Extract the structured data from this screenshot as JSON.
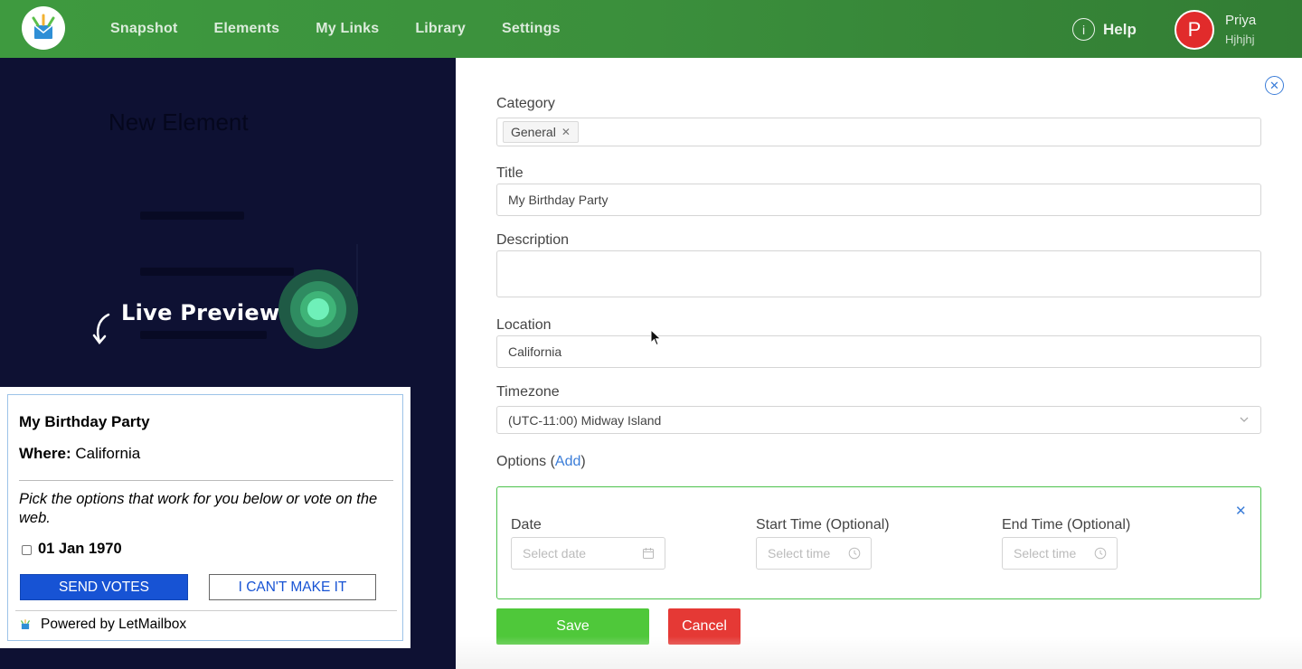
{
  "nav": {
    "items": [
      "Snapshot",
      "Elements",
      "My Links",
      "Library",
      "Settings"
    ],
    "help_label": "Help",
    "help_glyph": "i",
    "avatar_initial": "P",
    "user_name": "Priya",
    "user_sub": "Hjhjhj"
  },
  "left": {
    "ghost_title": "New Element",
    "live_preview": "Live Preview"
  },
  "preview": {
    "title": "My Birthday Party",
    "where_label": "Where:",
    "where_value": "California",
    "note": "Pick the options that work for you below or vote on the web.",
    "date_option": "01 Jan 1970",
    "send_votes": "SEND VOTES",
    "cant_make_it": "I CAN'T MAKE IT",
    "powered_by": "Powered by LetMailbox"
  },
  "form": {
    "category_label": "Category",
    "category_tag": "General",
    "title_label": "Title",
    "title_value": "My Birthday Party",
    "description_label": "Description",
    "description_value": "",
    "location_label": "Location",
    "location_value": "California",
    "timezone_label": "Timezone",
    "timezone_value": "(UTC-11:00) Midway Island",
    "options_label": "Options (",
    "options_add": "Add",
    "options_close": ")",
    "date_label": "Date",
    "date_placeholder": "Select date",
    "start_label": "Start Time (Optional)",
    "start_placeholder": "Select time",
    "end_label": "End Time (Optional)",
    "end_placeholder": "Select time",
    "save_label": "Save",
    "cancel_label": "Cancel"
  },
  "colors": {
    "nav_green": "#3e9a3f",
    "left_panel": "#0e1133",
    "accent_blue": "#3b7dd8",
    "save_green": "#4fc83a",
    "cancel_red": "#e53935",
    "option_border": "#4cc24c"
  }
}
